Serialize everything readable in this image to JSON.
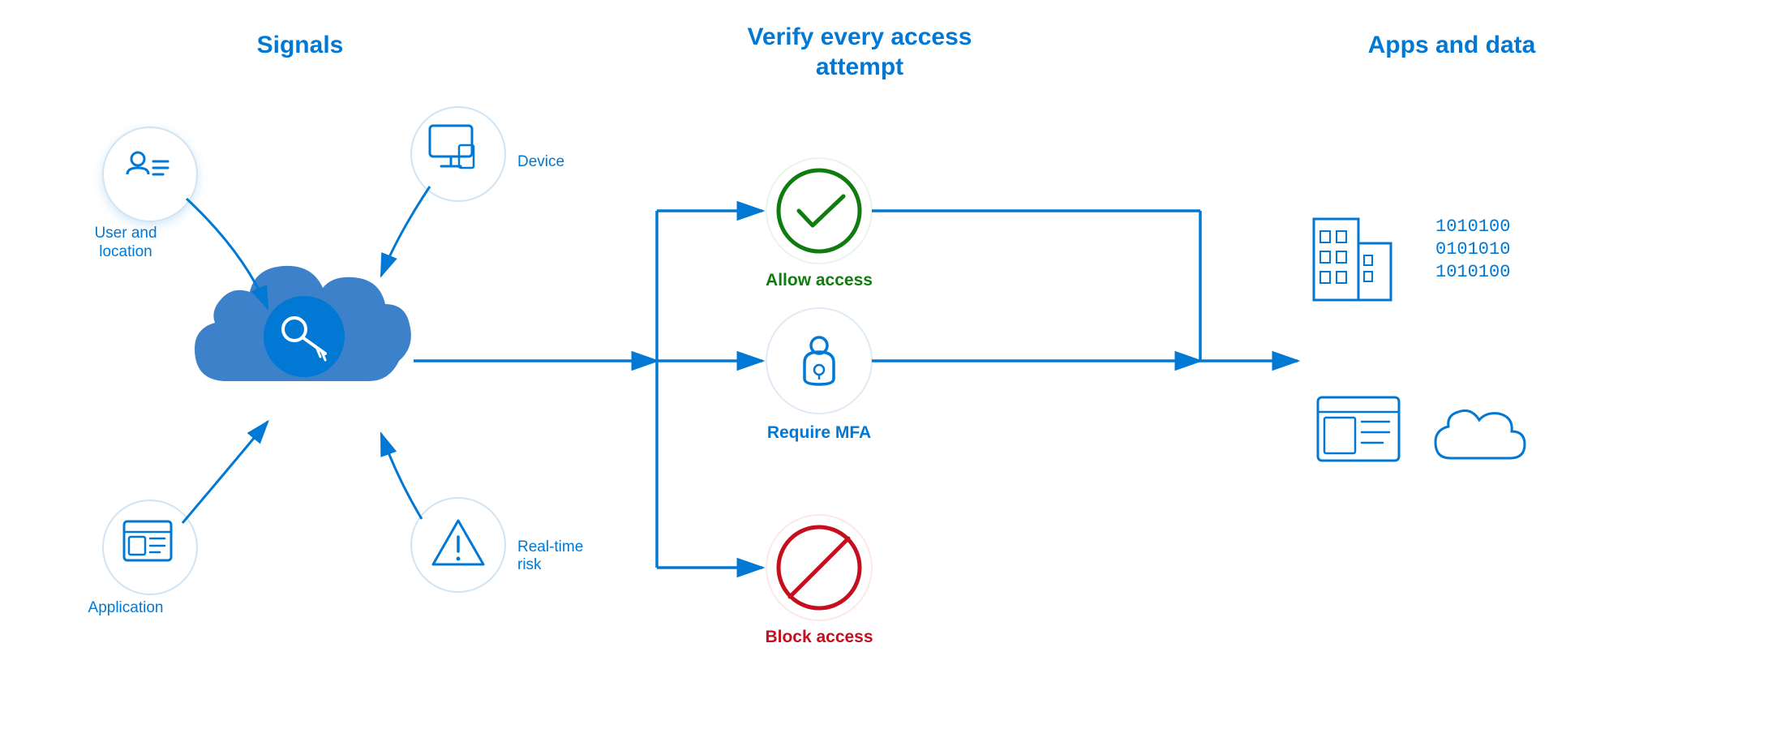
{
  "sections": {
    "signals": {
      "title": "Signals",
      "nodes": [
        {
          "id": "user-location",
          "label": "User and\nlocation",
          "position": "top-left"
        },
        {
          "id": "device",
          "label": "Device",
          "position": "top-right"
        },
        {
          "id": "application",
          "label": "Application",
          "position": "bottom-left"
        },
        {
          "id": "realtime-risk",
          "label": "Real-time\nrisk",
          "position": "bottom-right"
        }
      ]
    },
    "verify": {
      "title": "Verify every access\nattempt",
      "outcomes": [
        {
          "id": "allow",
          "label": "Allow access",
          "type": "allow"
        },
        {
          "id": "mfa",
          "label": "Require MFA",
          "type": "mfa"
        },
        {
          "id": "block",
          "label": "Block access",
          "type": "block"
        }
      ]
    },
    "apps": {
      "title": "Apps and data",
      "items": [
        {
          "id": "building",
          "label": "Building"
        },
        {
          "id": "data-binary",
          "label": "Binary data"
        },
        {
          "id": "app-window",
          "label": "App window"
        },
        {
          "id": "cloud-storage",
          "label": "Cloud storage"
        }
      ]
    }
  },
  "colors": {
    "blue": "#0078d4",
    "green": "#107c10",
    "red": "#c50f1f",
    "circle_bg": "#ffffff",
    "shadow": "rgba(0,120,212,0.18)"
  }
}
